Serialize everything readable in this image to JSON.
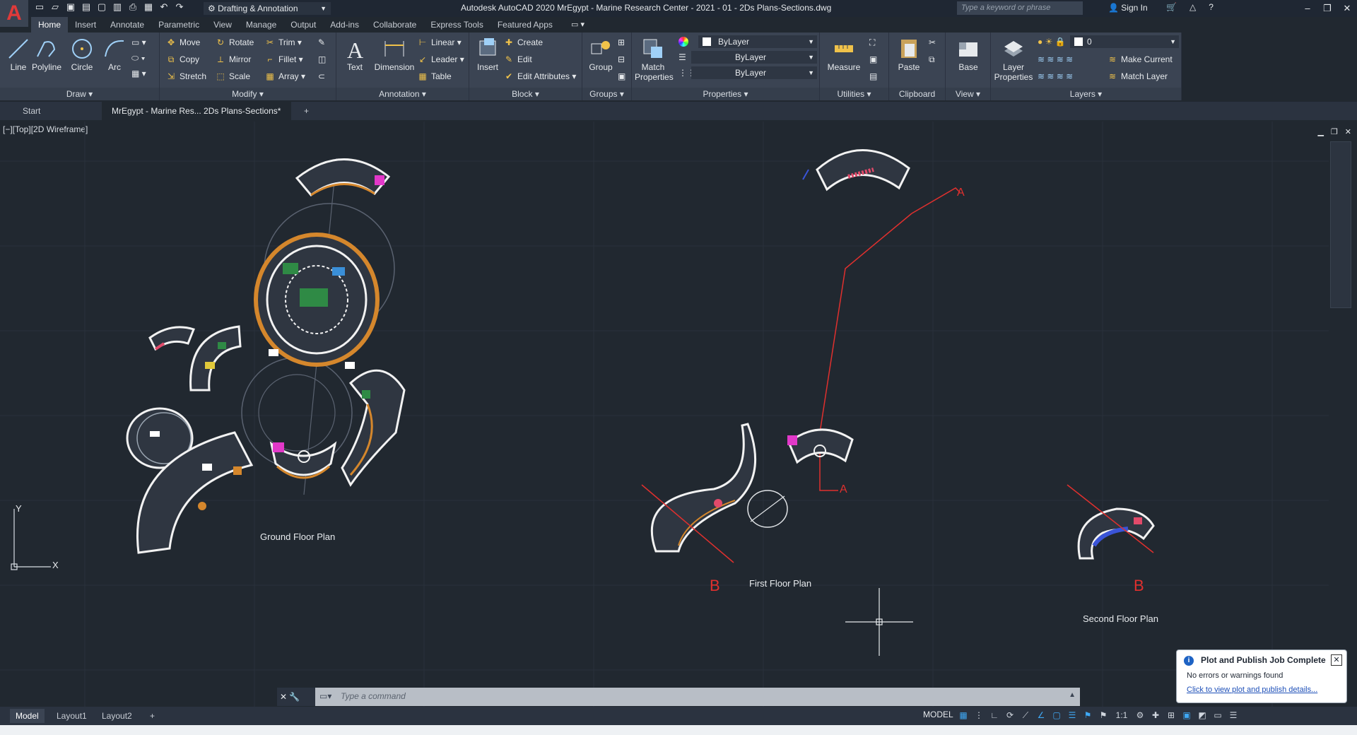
{
  "app": {
    "logo": "A",
    "title": "Autodesk AutoCAD 2020    MrEgypt - Marine Research Center - 2021 - 01 - 2Ds Plans-Sections.dwg",
    "workspace": "Drafting & Annotation",
    "search_placeholder": "Type a keyword or phrase",
    "sign_in": "Sign In"
  },
  "ribbon_tabs": [
    "Home",
    "Insert",
    "Annotate",
    "Parametric",
    "View",
    "Manage",
    "Output",
    "Add-ins",
    "Collaborate",
    "Express Tools",
    "Featured Apps"
  ],
  "ribbon": {
    "draw": {
      "title": "Draw",
      "line": "Line",
      "polyline": "Polyline",
      "circle": "Circle",
      "arc": "Arc"
    },
    "modify": {
      "title": "Modify",
      "move": "Move",
      "rotate": "Rotate",
      "trim": "Trim",
      "copy": "Copy",
      "mirror": "Mirror",
      "fillet": "Fillet",
      "stretch": "Stretch",
      "scale": "Scale",
      "array": "Array"
    },
    "annotation": {
      "title": "Annotation",
      "text": "Text",
      "dimension": "Dimension",
      "linear": "Linear",
      "leader": "Leader",
      "table": "Table"
    },
    "block": {
      "title": "Block",
      "insert": "Insert",
      "create": "Create",
      "edit": "Edit",
      "edit_attributes": "Edit Attributes"
    },
    "groups": {
      "title": "Groups",
      "group": "Group"
    },
    "properties": {
      "title": "Properties",
      "match": "Match Properties",
      "color": "ByLayer",
      "linetype": "ByLayer",
      "lineweight": "ByLayer"
    },
    "utilities": {
      "title": "Utilities",
      "measure": "Measure"
    },
    "clipboard": {
      "title": "Clipboard",
      "paste": "Paste"
    },
    "view": {
      "title": "View",
      "base": "Base"
    },
    "layers": {
      "title": "Layers",
      "layer_properties": "Layer Properties",
      "current_layer": "0",
      "make_current": "Make Current",
      "match_layer": "Match Layer"
    }
  },
  "doc_tabs": {
    "start": "Start",
    "active": "MrEgypt - Marine Res... 2Ds Plans-Sections*"
  },
  "viewport": {
    "label": "[−][Top][2D Wireframe]",
    "plans": [
      "Ground Floor Plan",
      "First Floor Plan",
      "Second Floor Plan"
    ],
    "section_marks": [
      "A",
      "A",
      "B",
      "B"
    ],
    "ucs": {
      "x": "X",
      "y": "Y"
    }
  },
  "command_line": {
    "placeholder": "Type a command"
  },
  "notification": {
    "title": "Plot and Publish Job Complete",
    "message": "No errors or warnings found",
    "link": "Click to view plot and publish details..."
  },
  "layouts": [
    "Model",
    "Layout1",
    "Layout2"
  ],
  "status": {
    "model": "MODEL",
    "scale": "1:1"
  },
  "colors": {
    "accent": "#3fa9f5",
    "section_line": "#e0302e",
    "canvas": "#212830",
    "ribbon": "#3b4453"
  }
}
